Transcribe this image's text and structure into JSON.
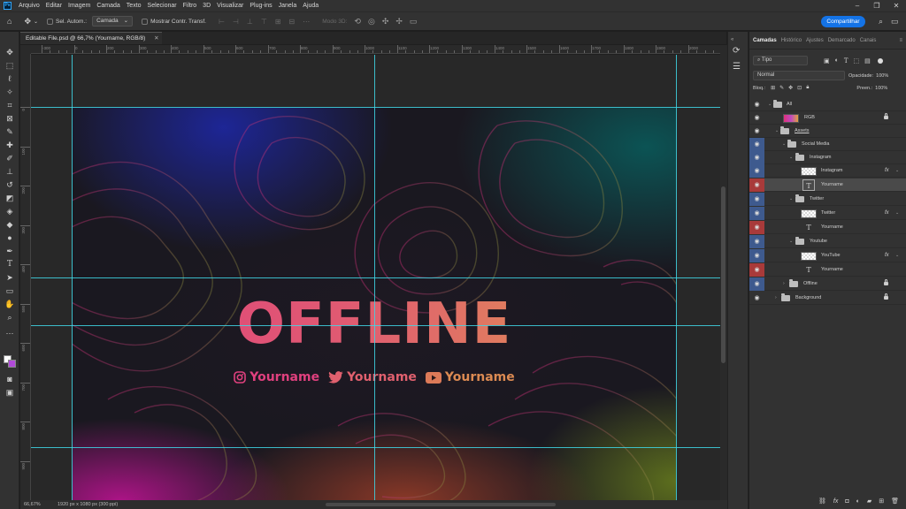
{
  "menubar": {
    "items": [
      "Arquivo",
      "Editar",
      "Imagem",
      "Camada",
      "Texto",
      "Selecionar",
      "Filtro",
      "3D",
      "Visualizar",
      "Plug-ins",
      "Janela",
      "Ajuda"
    ],
    "app_logo": "Ps"
  },
  "options": {
    "auto_select_label": "Sel. Autom.:",
    "auto_select_value": "Camada",
    "show_transform_label": "Mostrar Contr. Transf.",
    "mode_3d_label": "Modo 3D:",
    "share_label": "Compartilhar"
  },
  "document": {
    "tab_title": "Editable File.psd @ 66,7% (Yourname, RGB/8)",
    "zoom": "66,67%",
    "size_info": "1920 px x 1080 px (300 ppi)"
  },
  "ruler": {
    "h_labels": [
      "-300",
      "0",
      "200",
      "300",
      "400",
      "500",
      "600",
      "700",
      "800",
      "900",
      "1000",
      "1100",
      "1200",
      "1300",
      "1400",
      "1500",
      "1600",
      "1700",
      "1800",
      "1900",
      "2000"
    ],
    "v_labels": [
      "0",
      "100",
      "200",
      "300",
      "400",
      "500",
      "600",
      "700",
      "800",
      "900",
      "1000"
    ]
  },
  "canvas": {
    "headline": "OFFLINE",
    "socials": [
      {
        "icon": "instagram-icon",
        "label": "Yourname"
      },
      {
        "icon": "twitter-icon",
        "label": "Yourname"
      },
      {
        "icon": "youtube-icon",
        "label": "Yourname"
      }
    ],
    "colors": {
      "pink": "#e0407e",
      "coral": "#e06a6a",
      "orange": "#dc8a52",
      "guide": "#3fd7e6"
    }
  },
  "panel": {
    "tabs": [
      "Camadas",
      "Histórico",
      "Ajustes",
      "Demarcado",
      "Canais"
    ],
    "filter_label": "Tipo",
    "blend_mode": "Normal",
    "opacity_label": "Opacidade:",
    "opacity_value": "100%",
    "lock_label": "Bloq.:",
    "fill_label": "Preen.:",
    "fill_value": "100%",
    "layers": [
      {
        "name": "All",
        "kind": "group"
      },
      {
        "name": "RGB",
        "kind": "gradient"
      },
      {
        "name": "Assets",
        "kind": "group"
      },
      {
        "name": "Social Media",
        "kind": "group"
      },
      {
        "name": "Instagram",
        "kind": "group"
      },
      {
        "name": "Instagram",
        "kind": "smart"
      },
      {
        "name": "Yourname",
        "kind": "text"
      },
      {
        "name": "Twitter",
        "kind": "group"
      },
      {
        "name": "Twitter",
        "kind": "smart"
      },
      {
        "name": "Yourname",
        "kind": "text"
      },
      {
        "name": "Youtube",
        "kind": "group"
      },
      {
        "name": "YouTube",
        "kind": "smart"
      },
      {
        "name": "Yourname",
        "kind": "text"
      },
      {
        "name": "Offline",
        "kind": "group"
      },
      {
        "name": "Background",
        "kind": "group"
      }
    ],
    "fx_label": "fx"
  }
}
